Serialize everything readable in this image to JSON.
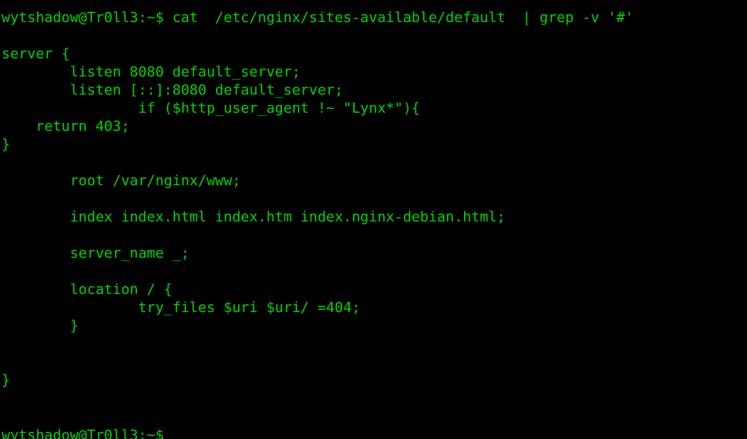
{
  "terminal": {
    "colors": {
      "background": "#000000",
      "foreground": "#00d400"
    },
    "lines": [
      "",
      "wytshadow@Tr0ll3:~$ cat  /etc/nginx/sites-available/default  | grep -v '#'",
      "",
      "server {",
      "        listen 8080 default_server;",
      "        listen [::]:8080 default_server;",
      "                if ($http_user_agent !~ \"Lynx*\"){",
      "    return 403;",
      "}",
      "",
      "        root /var/nginx/www;",
      "",
      "        index index.html index.htm index.nginx-debian.html;",
      "",
      "        server_name _;",
      "",
      "        location / {",
      "                try_files $uri $uri/ =404;",
      "        }",
      "",
      "",
      "}",
      "",
      "",
      "wytshadow@Tr0ll3:~$ "
    ]
  }
}
